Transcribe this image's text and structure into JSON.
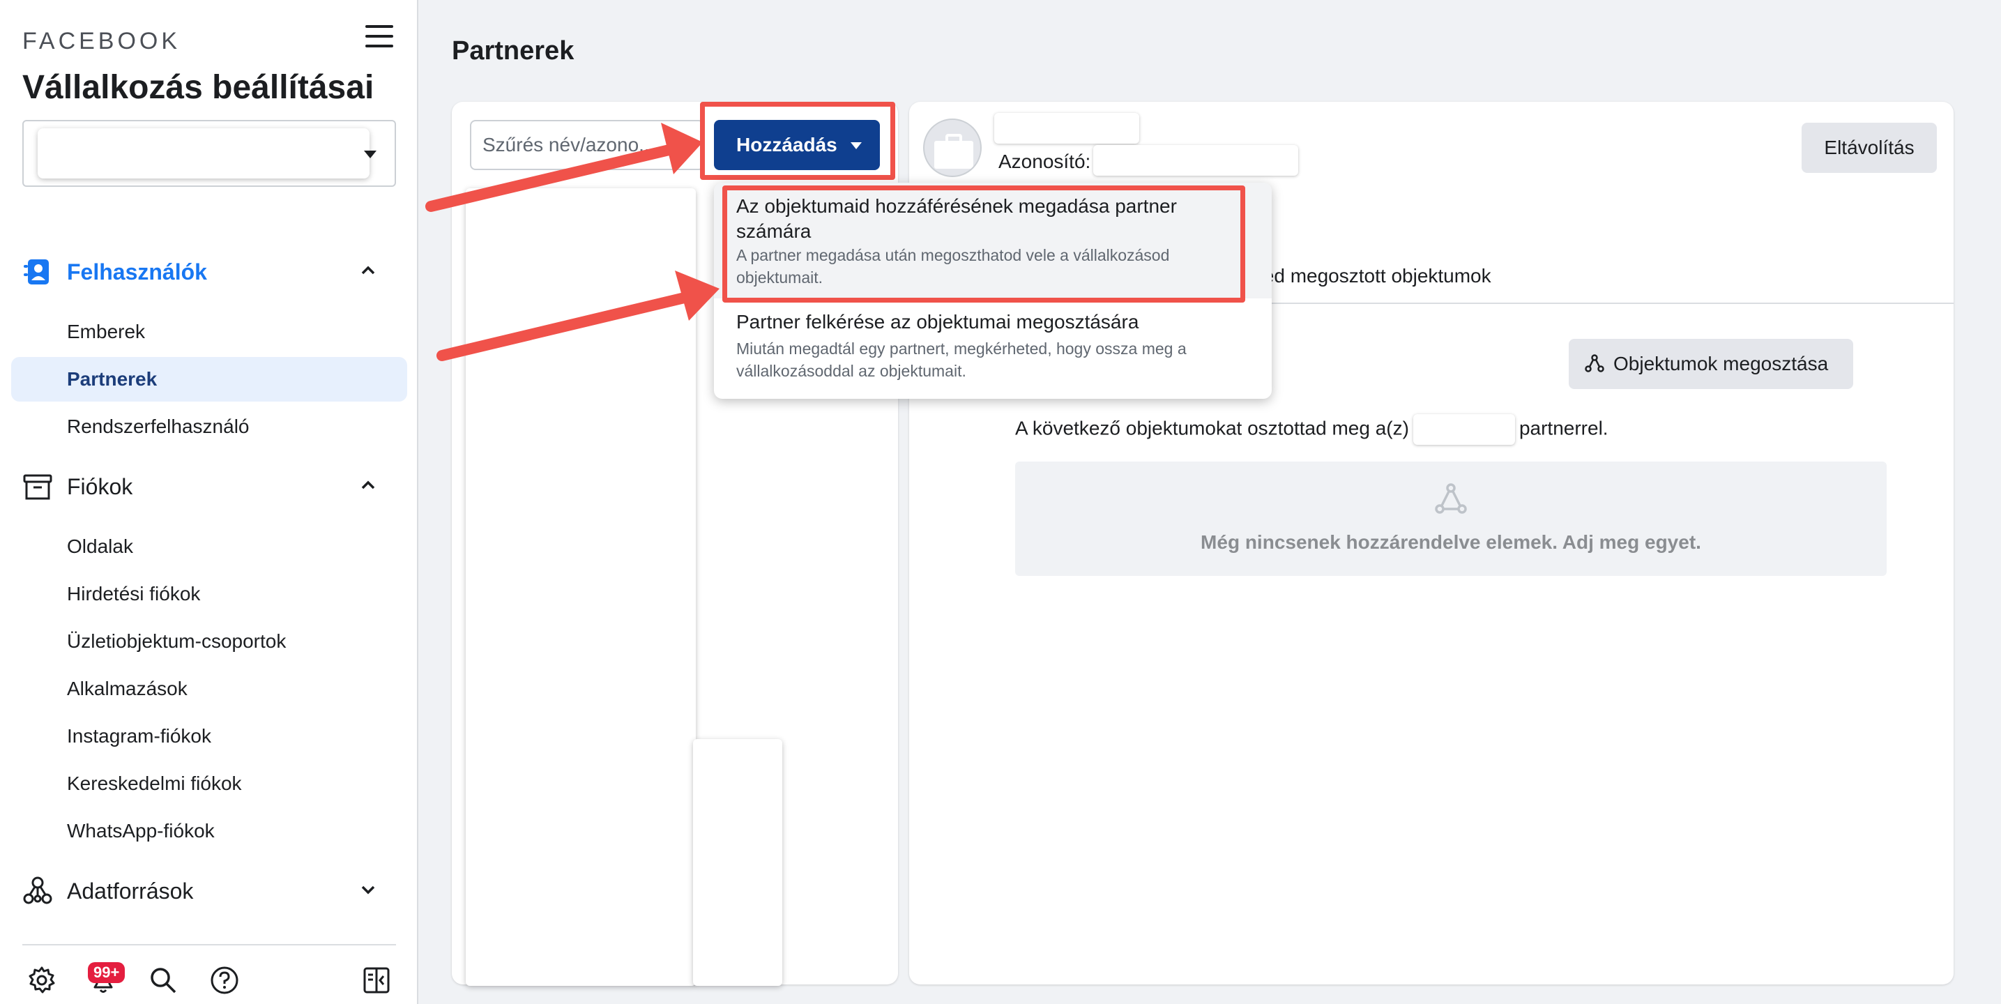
{
  "sidebar": {
    "brand": "FACEBOOK",
    "business_settings_title": "Vállalkozás beállításai",
    "sections": {
      "users": {
        "label": "Felhasználók",
        "items": [
          "Emberek",
          "Partnerek",
          "Rendszerfelhasználó"
        ],
        "active": "Partnerek"
      },
      "accounts": {
        "label": "Fiókok",
        "items": [
          "Oldalak",
          "Hirdetési fiókok",
          "Üzletiobjektum-csoportok",
          "Alkalmazások",
          "Instagram-fiókok",
          "Kereskedelmi fiókok",
          "WhatsApp-fiókok"
        ]
      },
      "data_sources": {
        "label": "Adatforrások"
      }
    },
    "footer": {
      "notification_badge": "99+"
    }
  },
  "main": {
    "page_title": "Partnerek",
    "filter": {
      "placeholder": "Szűrés név/azono..."
    },
    "add_button_label": "Hozzáadás",
    "dropdown": {
      "items": [
        {
          "title": "Az objektumaid hozzáférésének megadása partner számára",
          "subtitle": "A partner megadása után megoszthatod vele a vállalkozásod objektumait."
        },
        {
          "title": "Partner felkérése az objektumai megosztására",
          "subtitle": "Miután megadtál egy partnert, megkérheted, hogy ossza meg a vállalkozásoddal az objektumait."
        }
      ]
    },
    "detail": {
      "id_label": "Azonosító:",
      "remove_button_label": "Eltávolítás",
      "tab_label_visible": "eled megosztott objektumok",
      "share_button_label": "Objektumok megosztása",
      "shared_text_before": "A következő objektumokat osztottad meg a(z)",
      "shared_text_after": "partnerrel.",
      "empty_state_text": "Még nincsenek hozzárendelve elemek. Adj meg egyet."
    }
  },
  "colors": {
    "accent_blue": "#1877f2",
    "primary_button": "#0f3f8f",
    "highlight_red": "#f0524a",
    "active_nav_bg": "#e7f0fd"
  },
  "icons": {
    "menu": "hamburger-icon",
    "users": "users-badge-icon",
    "accounts": "archive-box-icon",
    "data_sources": "data-sources-network-icon",
    "settings": "gear-icon",
    "notifications": "bell-icon",
    "search": "search-icon",
    "help": "help-icon",
    "panel_toggle": "panel-toggle-icon",
    "share": "share-nodes-icon"
  }
}
